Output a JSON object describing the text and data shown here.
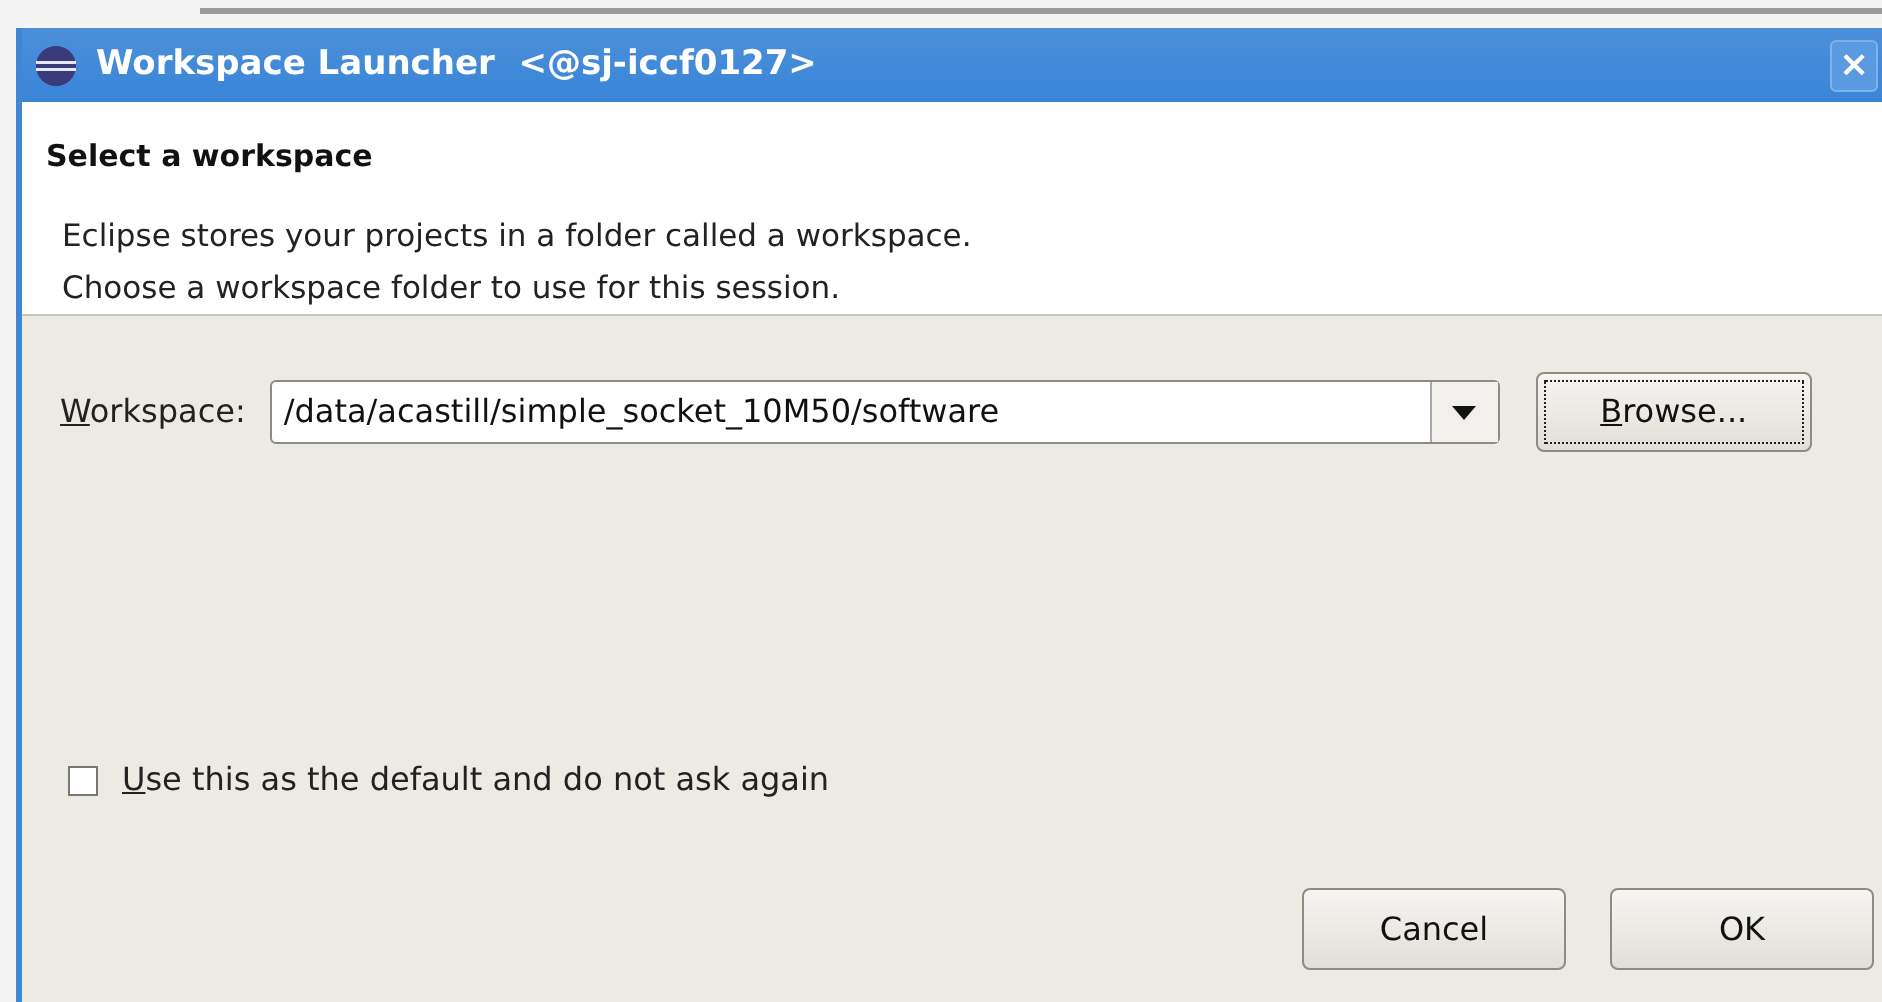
{
  "window": {
    "title": "Workspace Launcher  <@sj-iccf0127>",
    "close": "×"
  },
  "header": {
    "title": "Select a workspace",
    "lines": [
      "Eclipse stores your projects in a folder called a workspace.",
      "Choose a workspace folder to use for this session."
    ]
  },
  "workspace": {
    "label": "Workspace:",
    "value": "/data/acastill/simple_socket_10M50/software",
    "browse": "Browse..."
  },
  "default_option": {
    "label": "Use this as the default and do not ask again",
    "checked": false
  },
  "buttons": [
    {
      "label": "Cancel"
    },
    {
      "label": "OK"
    }
  ]
}
